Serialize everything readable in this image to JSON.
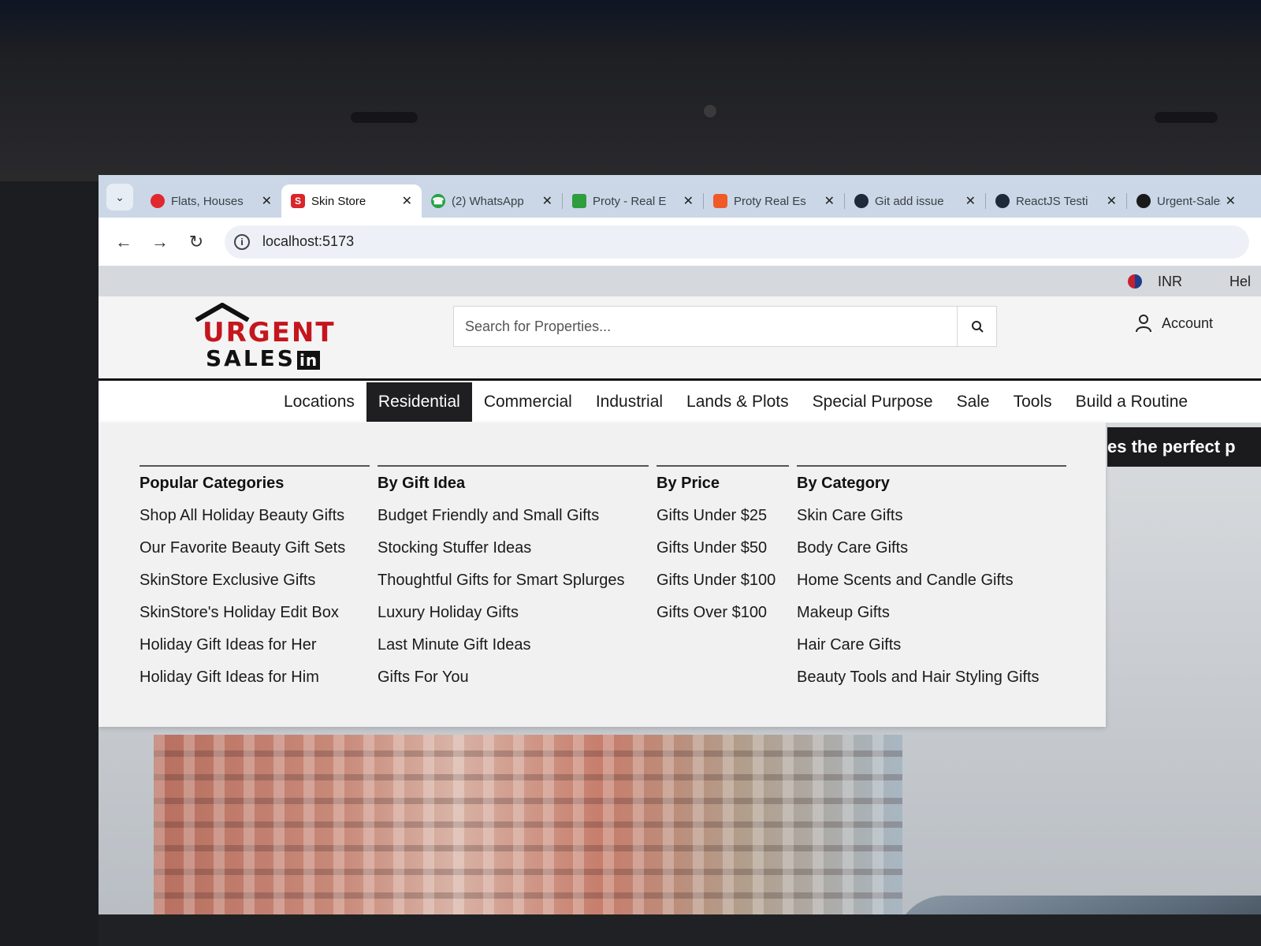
{
  "tabs": [
    {
      "title": "Flats, Houses",
      "favicon": "red-circle-icon",
      "color": "#e0282e"
    },
    {
      "title": "Skin Store",
      "favicon": "s-logo-icon",
      "color": "#d9252b",
      "active": true
    },
    {
      "title": "(2) WhatsApp",
      "favicon": "whatsapp-icon",
      "color": "#25a244"
    },
    {
      "title": "Proty - Real E",
      "favicon": "green-square-icon",
      "color": "#2e9d3e"
    },
    {
      "title": "Proty Real Es",
      "favicon": "orange-shield-icon",
      "color": "#f05a28"
    },
    {
      "title": "Git add issue",
      "favicon": "dark-circle-icon",
      "color": "#1e2a3a"
    },
    {
      "title": "ReactJS Testi",
      "favicon": "dark-circle-icon",
      "color": "#1e2a3a"
    },
    {
      "title": "Urgent-Sales",
      "favicon": "github-icon",
      "color": "#1a1a1a"
    }
  ],
  "address": {
    "url": "localhost:5173"
  },
  "utility": {
    "currency": "INR",
    "help": "Hel"
  },
  "header": {
    "logo_line1": "URGENT",
    "logo_line2": "SALES",
    "logo_badge": "in",
    "search_placeholder": "Search for Properties...",
    "account_label": "Account"
  },
  "nav": [
    {
      "label": "Locations"
    },
    {
      "label": "Residential",
      "active": true
    },
    {
      "label": "Commercial"
    },
    {
      "label": "Industrial"
    },
    {
      "label": "Lands & Plots"
    },
    {
      "label": "Special Purpose"
    },
    {
      "label": "Sale"
    },
    {
      "label": "Tools"
    },
    {
      "label": "Build a Routine"
    }
  ],
  "hero": {
    "banner_text": "es the perfect p"
  },
  "megamenu": {
    "columns": [
      {
        "heading": "Popular Categories",
        "links": [
          "Shop All Holiday Beauty Gifts",
          "Our Favorite Beauty Gift Sets",
          "SkinStore Exclusive Gifts",
          "SkinStore's Holiday Edit Box",
          "Holiday Gift Ideas for Her",
          "Holiday Gift Ideas for Him"
        ]
      },
      {
        "heading": "By Gift Idea",
        "links": [
          "Budget Friendly and Small Gifts",
          "Stocking Stuffer Ideas",
          "Thoughtful Gifts for Smart Splurges",
          "Luxury Holiday Gifts",
          "Last Minute Gift Ideas",
          "Gifts For You"
        ]
      },
      {
        "heading": "By Price",
        "links": [
          "Gifts Under $25",
          "Gifts Under $50",
          "Gifts Under $100",
          "Gifts Over $100"
        ]
      },
      {
        "heading": "By Category",
        "links": [
          "Skin Care Gifts",
          "Body Care Gifts",
          "Home Scents and Candle Gifts",
          "Makeup Gifts",
          "Hair Care Gifts",
          "Beauty Tools and Hair Styling Gifts"
        ]
      }
    ]
  }
}
